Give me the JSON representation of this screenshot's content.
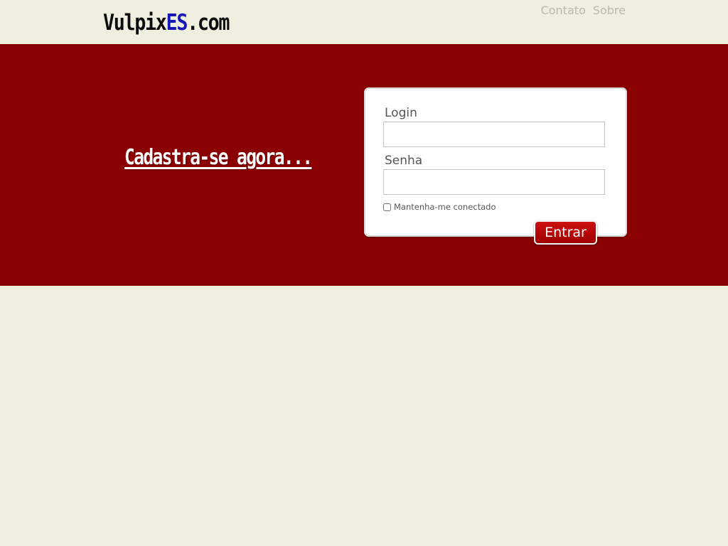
{
  "header": {
    "logo_prefix": "Vulpix",
    "logo_accent": "ES",
    "logo_suffix": ".com",
    "nav": {
      "contato": "Contato",
      "sobre": "Sobre"
    }
  },
  "hero": {
    "signup_label": "Cadastra-se agora...",
    "login": {
      "login_label": "Login",
      "login_value": "",
      "senha_label": "Senha",
      "senha_value": "",
      "remember_label": "Mantenha-me conectado",
      "remember_checked": false,
      "submit_label": "Entrar"
    }
  },
  "colors": {
    "background": "#efefdf",
    "hero": "#8b0000",
    "logo_accent": "#1517b8",
    "nav_text": "#b8b8ae",
    "button": "#b80808"
  }
}
